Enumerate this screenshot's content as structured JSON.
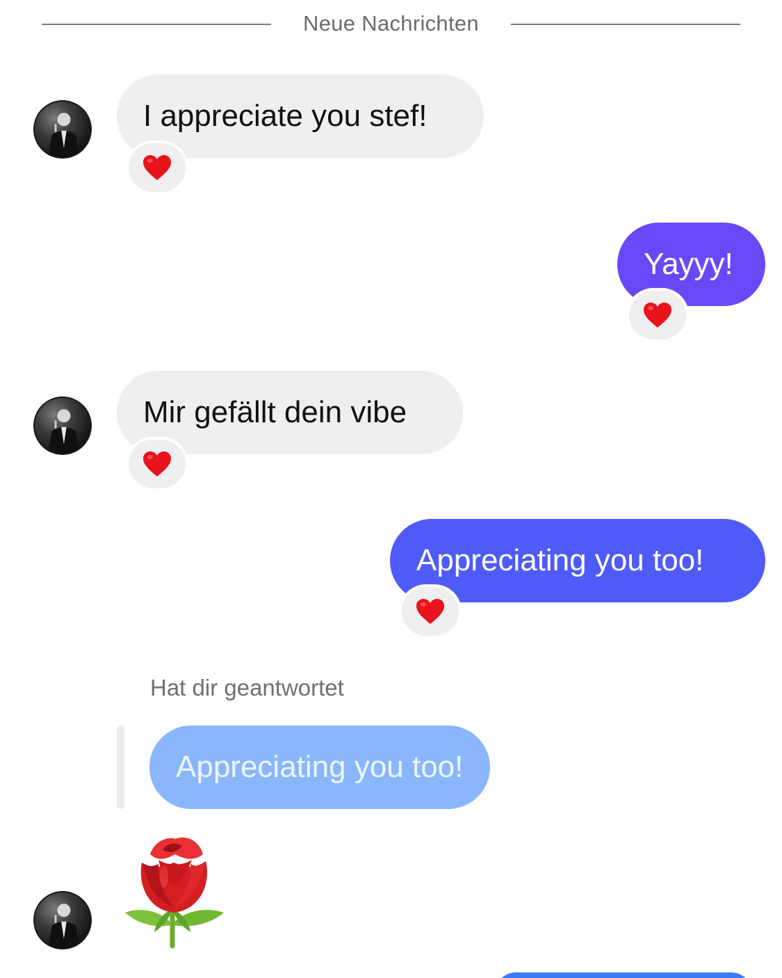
{
  "divider": {
    "label": "Neue Nachrichten"
  },
  "messages": [
    {
      "text": "I appreciate you stef!",
      "direction": "incoming",
      "reaction": "heart"
    },
    {
      "text": "Yayyy!",
      "direction": "outgoing",
      "reaction": "heart"
    },
    {
      "text": "Mir gefällt dein vibe",
      "direction": "incoming",
      "reaction": "heart"
    },
    {
      "text": "Appreciating you too!",
      "direction": "outgoing",
      "reaction": "heart"
    }
  ],
  "reply": {
    "label": "Hat dir geantwortet",
    "quoted_text": "Appreciating you too!"
  },
  "rose_message": {
    "emoji": "rose"
  },
  "colors": {
    "incoming_bubble": "#efefef",
    "outgoing_purple": "#6a48f8",
    "outgoing_indigo": "#4f5bf8",
    "quoted_bubble": "#8ab7fc",
    "reaction_heart": "#e8131b"
  }
}
